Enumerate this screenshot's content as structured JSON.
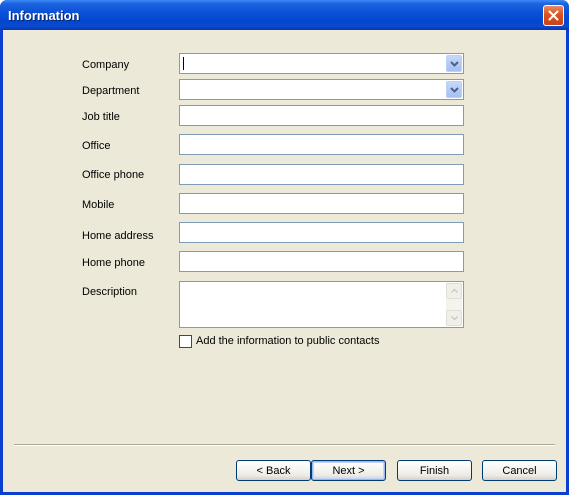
{
  "window": {
    "title": "Information",
    "accent": "#0a52d9"
  },
  "form": {
    "company_label": "Company",
    "company_value": "",
    "department_label": "Department",
    "department_value": "",
    "job_title_label": "Job title",
    "job_title_value": "",
    "office_label": "Office",
    "office_value": "",
    "office_phone_label": "Office phone",
    "office_phone_value": "",
    "mobile_label": "Mobile",
    "mobile_value": "",
    "home_address_label": "Home address",
    "home_address_value": "",
    "home_phone_label": "Home phone",
    "home_phone_value": "",
    "description_label": "Description",
    "description_value": "",
    "public_contacts_label": "Add the information to public contacts",
    "public_contacts_checked": false
  },
  "buttons": {
    "back": "< Back",
    "next": "Next >",
    "finish": "Finish",
    "cancel": "Cancel"
  }
}
